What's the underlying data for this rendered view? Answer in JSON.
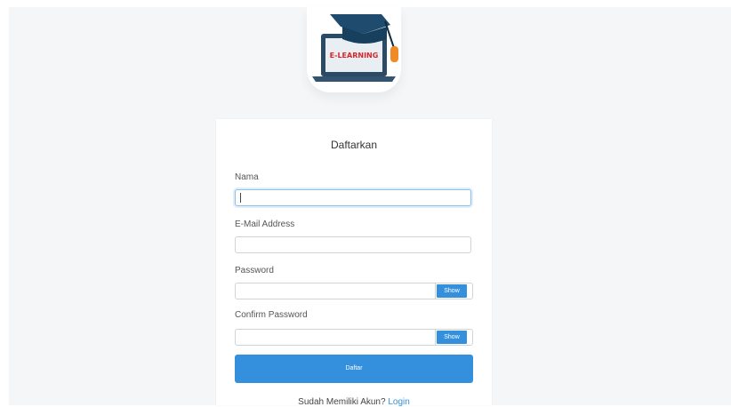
{
  "logo": {
    "text": "E-LEARNING",
    "icon": "laptop-graduation-cap-icon"
  },
  "form": {
    "title": "Daftarkan",
    "name_label": "Nama",
    "name_value": "",
    "email_label": "E-Mail Address",
    "email_value": "",
    "password_label": "Password",
    "password_value": "",
    "password_show_label": "Show",
    "confirm_label": "Confirm Password",
    "confirm_value": "",
    "confirm_show_label": "Show",
    "submit_label": "Daftar"
  },
  "footer": {
    "prompt": "Sudah Memiliki Akun?",
    "login_link": "Login"
  },
  "colors": {
    "primary": "#3490dc",
    "background": "#f4f6f8",
    "logo_text": "#d7262a",
    "tassel": "#f08a24",
    "cap": "#1f4b6e"
  }
}
